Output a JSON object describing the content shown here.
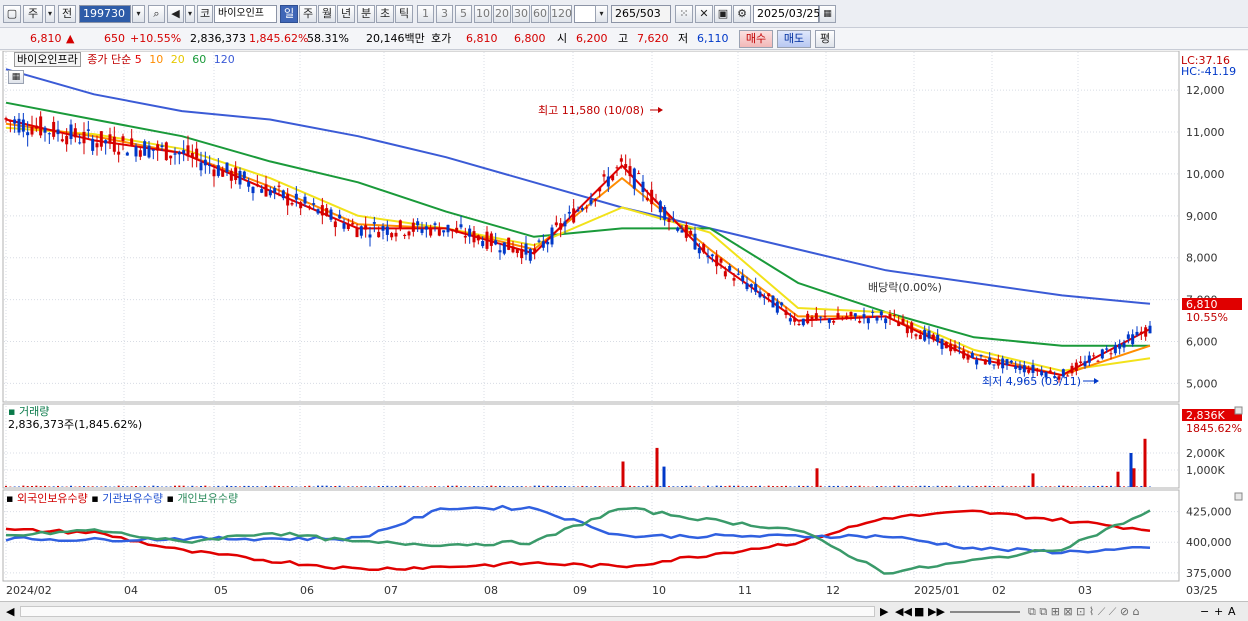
{
  "toolbar": {
    "mode_label": "주",
    "prev_label": "전",
    "code_value": "199730",
    "exchange_label": "코",
    "stock_name": "바이오인프",
    "period_tabs": [
      "일",
      "주",
      "월",
      "년",
      "분",
      "초",
      "틱"
    ],
    "active_period": "일",
    "intervals": [
      "1",
      "3",
      "5",
      "10",
      "20",
      "30",
      "60",
      "120"
    ],
    "count_value": "265",
    "count_total": "/503",
    "date_value": "2025/03/25"
  },
  "quote": {
    "price": "6,810",
    "up_symbol": "▲",
    "change": "650",
    "change_pct": "+10.55%",
    "volume": "2,836,373",
    "volume_pct": "1,845.62%",
    "turnover_pct": "58.31%",
    "amount": "20,146백만",
    "bid_label": "호가",
    "bid1": "6,810",
    "bid2": "6,800",
    "open_label": "시",
    "open": "6,200",
    "high_label": "고",
    "high": "7,620",
    "low_label": "저",
    "low": "6,110",
    "buy_label": "매수",
    "sell_label": "매도",
    "eval_label": "평"
  },
  "price_panel": {
    "name_tag": "바이오인프라",
    "ma_title": "종가 단순",
    "ma_periods": [
      "5",
      "10",
      "20",
      "60",
      "120"
    ],
    "lc_label": "LC:37.16",
    "hc_label": "HC:-41.19",
    "high_annotation": "최고 11,580 (10/08)",
    "low_annotation": "최저 4,965 (03/11)",
    "dividend_annotation": "배당락(0.00%)",
    "current_price_tag": "6,810",
    "current_pct_tag": "10.55%",
    "y_ticks": [
      "12,000",
      "11,000",
      "10,000",
      "9,000",
      "8,000",
      "7,000",
      "6,000",
      "5,000"
    ]
  },
  "volume_panel": {
    "title": "거래량",
    "value_text": "2,836,373주(1,845.62%)",
    "tag_value": "2,836K",
    "tag_pct": "1845.62%",
    "y_ticks": [
      "2,000K",
      "1,000K"
    ]
  },
  "holdings_panel": {
    "legend": [
      "외국인보유수량",
      "기관보유수량",
      "개인보유수량"
    ],
    "y_ticks": [
      "425,000",
      "400,000",
      "375,000"
    ]
  },
  "x_axis": {
    "labels": [
      "2024/02",
      "04",
      "05",
      "06",
      "07",
      "08",
      "09",
      "10",
      "11",
      "12",
      "2025/01",
      "02",
      "03"
    ],
    "right_label": "03/25"
  },
  "colors": {
    "up": "#d40000",
    "down": "#0038c8",
    "ma5": "#e00000",
    "ma10": "#ff8c00",
    "ma20": "#f2e21a",
    "ma60": "#1a9a3a",
    "ma120": "#3b5bd6",
    "foreign": "#e00000",
    "institution": "#3060e0",
    "individual": "#3a9a6a"
  },
  "chart_data": [
    {
      "type": "line",
      "title": "종가 단순",
      "ylim": [
        4700,
        12600
      ],
      "x": [
        "2024/02",
        "04",
        "05",
        "06",
        "07",
        "08",
        "09",
        "10",
        "11",
        "12",
        "2025/01",
        "02",
        "03",
        "03/25"
      ],
      "series": [
        {
          "name": "5",
          "values": [
            11300,
            10800,
            10500,
            9600,
            8700,
            8700,
            8100,
            10200,
            8000,
            6500,
            6600,
            5600,
            5200,
            6300
          ]
        },
        {
          "name": "10",
          "values": [
            11200,
            10900,
            10500,
            9700,
            8800,
            8700,
            8200,
            9900,
            8200,
            6600,
            6600,
            5700,
            5200,
            5900
          ]
        },
        {
          "name": "20",
          "values": [
            11100,
            10950,
            10600,
            9900,
            9000,
            8700,
            8300,
            9200,
            8600,
            6800,
            6700,
            5800,
            5300,
            5600
          ]
        },
        {
          "name": "60",
          "values": [
            11700,
            11300,
            10900,
            10300,
            9800,
            9100,
            8500,
            8700,
            8700,
            7400,
            6700,
            6100,
            5900,
            5900
          ]
        },
        {
          "name": "120",
          "values": [
            12500,
            11900,
            11500,
            11300,
            10900,
            10400,
            9800,
            9200,
            8700,
            8200,
            7700,
            7400,
            7100,
            6900
          ]
        }
      ]
    },
    {
      "type": "bar",
      "title": "거래량",
      "ylim": [
        0,
        3000
      ],
      "spikes": [
        {
          "x": "09",
          "value": 1500
        },
        {
          "x": "10",
          "value": 2300
        },
        {
          "x": "10",
          "value": 1200
        },
        {
          "x": "11",
          "value": 1100
        },
        {
          "x": "2025/02",
          "value": 800
        },
        {
          "x": "03",
          "value": 900
        },
        {
          "x": "03",
          "value": 1100
        },
        {
          "x": "03",
          "value": 2000
        },
        {
          "x": "03/25",
          "value": 2836
        }
      ]
    },
    {
      "type": "line",
      "title": "보유수량",
      "ylim": [
        370000,
        432000
      ],
      "x": [
        "2024/02",
        "04",
        "05",
        "06",
        "07",
        "08",
        "09",
        "10",
        "11",
        "12",
        "2025/01",
        "02",
        "03",
        "03/25"
      ],
      "series": [
        {
          "name": "외국인보유수량",
          "values": [
            410000,
            408000,
            393000,
            385000,
            378000,
            380000,
            383000,
            380000,
            390000,
            400000,
            420000,
            425000,
            418000,
            410000
          ]
        },
        {
          "name": "기관보유수량",
          "values": [
            403000,
            402000,
            403000,
            403000,
            403000,
            428000,
            428000,
            405000,
            405000,
            405000,
            405000,
            395000,
            392000,
            395000
          ]
        },
        {
          "name": "개인보유수량",
          "values": [
            405000,
            410000,
            400000,
            408000,
            400000,
            398000,
            400000,
            428000,
            418000,
            410000,
            375000,
            385000,
            395000,
            425000
          ]
        }
      ]
    }
  ]
}
